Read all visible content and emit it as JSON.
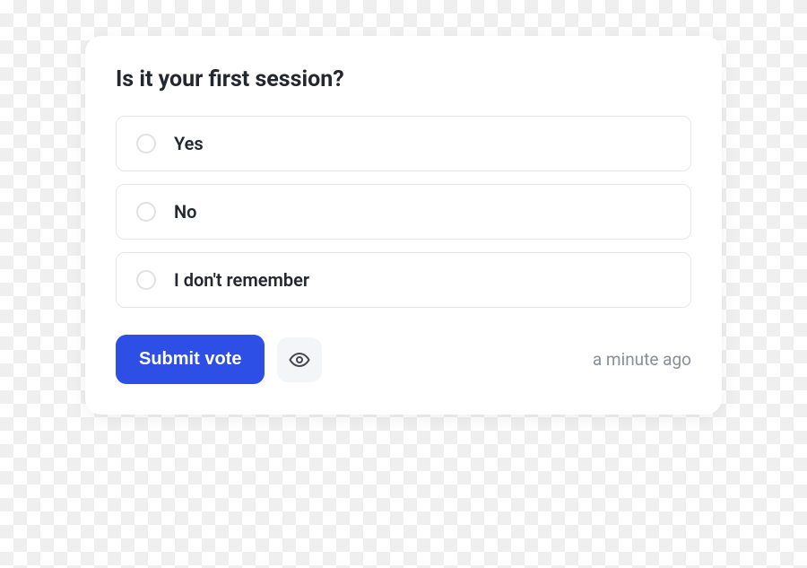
{
  "poll": {
    "question": "Is it your first session?",
    "options": [
      {
        "label": "Yes"
      },
      {
        "label": "No"
      },
      {
        "label": "I don't remember"
      }
    ],
    "submit_label": "Submit vote",
    "timestamp": "a minute ago"
  }
}
